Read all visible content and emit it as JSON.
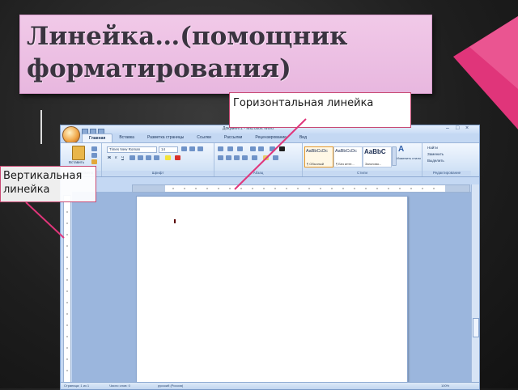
{
  "slide": {
    "title": "Линейка…(помощник форматирования)",
    "accent_color": "#e0357a",
    "title_bg": "#ebbfe3"
  },
  "callouts": {
    "horizontal": "Горизонтальная линейка",
    "vertical": "Вертикальная линейка"
  },
  "word": {
    "window_title": "Документ1 - Microsoft Word",
    "tabs": [
      "Главная",
      "Вставка",
      "Разметка страницы",
      "Ссылки",
      "Рассылки",
      "Рецензирование",
      "Вид"
    ],
    "active_tab": "Главная",
    "groups": {
      "clipboard": "Буфер обмена",
      "font": "Шрифт",
      "paragraph": "Абзац",
      "styles": "Стили",
      "editing": "Редактирование"
    },
    "paste_label": "Вставить",
    "font_name": "Times New Roman",
    "font_size": "14",
    "styles": [
      {
        "sample": "AaBbCcDc",
        "name": "¶ Обычный"
      },
      {
        "sample": "AaBbCcDc",
        "name": "¶ Без инте..."
      },
      {
        "sample": "AaBbC",
        "name": "Заголово..."
      }
    ],
    "change_styles": "Изменить стили",
    "editing_items": [
      "Найти",
      "Заменить",
      "Выделить"
    ],
    "status": {
      "page": "Страница: 1 из 1",
      "words": "Число слов: 0",
      "language": "русский (Россия)",
      "zoom": "100%"
    }
  }
}
